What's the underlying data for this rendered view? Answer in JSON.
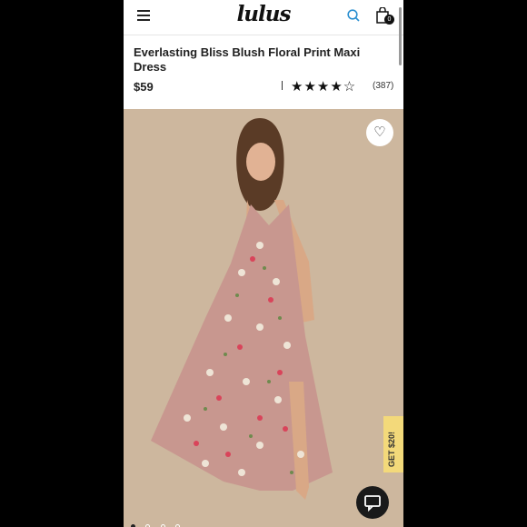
{
  "header": {
    "logo_text": "lulus",
    "menu_icon": "hamburger-icon",
    "search_icon": "search-icon",
    "bag_icon": "shopping-bag-icon",
    "bag_count": "0"
  },
  "product": {
    "title": "Everlasting Bliss Blush Floral Print Maxi Dress",
    "price": "$59",
    "rating_stars": "★★★★☆",
    "rating_value": 4.5,
    "review_count": "(387)"
  },
  "gallery": {
    "wishlist_icon": "heart-icon",
    "promo_label": "GET $20!",
    "chat_icon": "chat-icon",
    "dot_count": 4,
    "active_dot": 1
  },
  "colors": {
    "background": "#000000",
    "photo_background": "#cdb79e",
    "dress": "#c8978f",
    "promo": "#f3d97a",
    "chat": "#1a1a1a"
  }
}
